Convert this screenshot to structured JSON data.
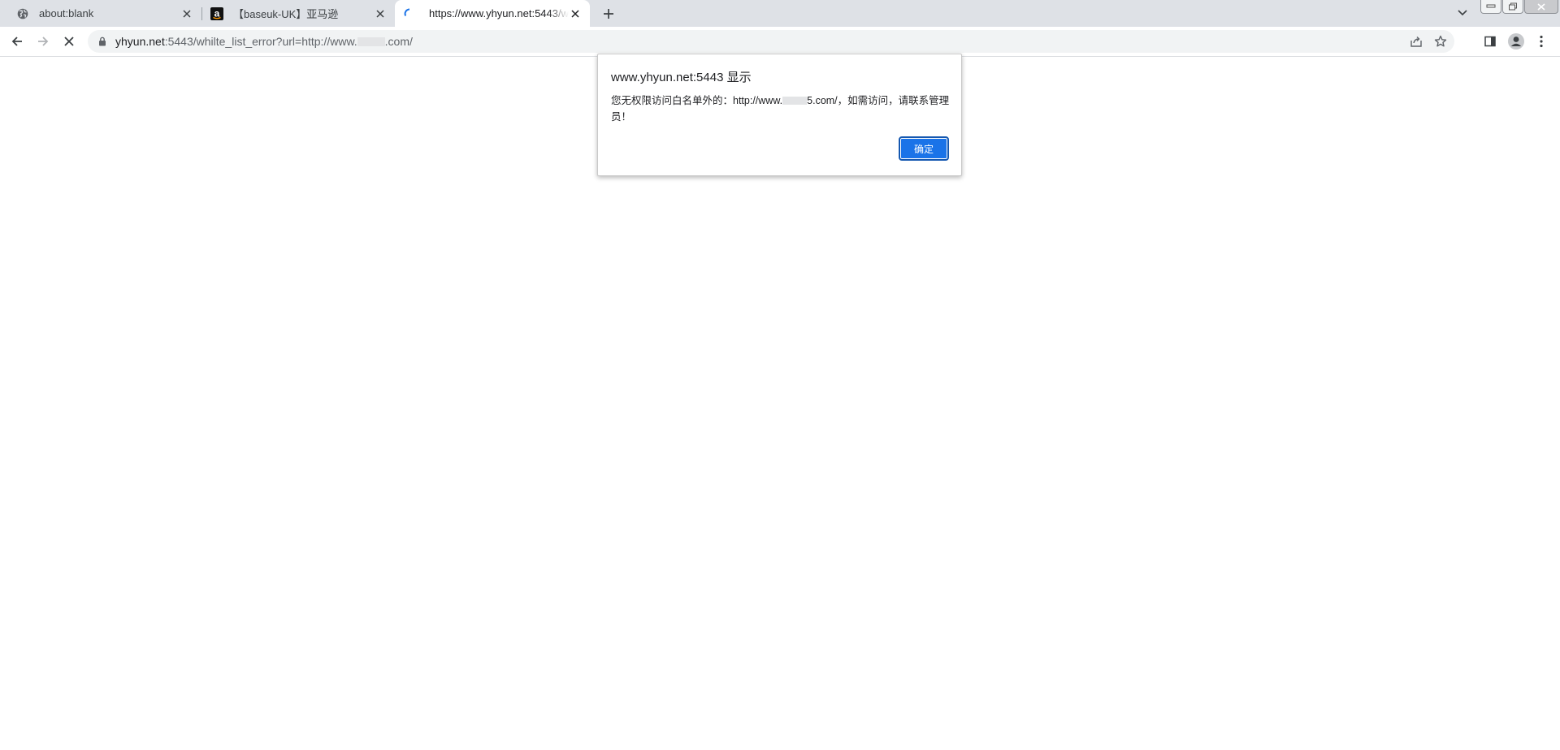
{
  "tabs": [
    {
      "title": "about:blank",
      "favicon": "globe-icon"
    },
    {
      "title": "【baseuk-UK】亚马逊",
      "favicon": "amazon-logo-icon"
    },
    {
      "title": "https://www.yhyun.net:5443/w",
      "favicon": "loading-spinner-icon",
      "active": true
    }
  ],
  "omnibox": {
    "host": "yhyun.net",
    "rest_before_mask": ":5443/whilte_list_error?url=http://www.",
    "rest_after_mask": ".com/"
  },
  "dialog": {
    "title": "www.yhyun.net:5443 显示",
    "message_before_mask": "您无权限访问白名单外的：http://www.",
    "message_after_mask": "5.com/，如需访问，请联系管理员！",
    "ok_label": "确定"
  },
  "colors": {
    "tabstrip": "#dee1e6",
    "omnibox": "#f1f3f4",
    "accent": "#1a73e8"
  }
}
